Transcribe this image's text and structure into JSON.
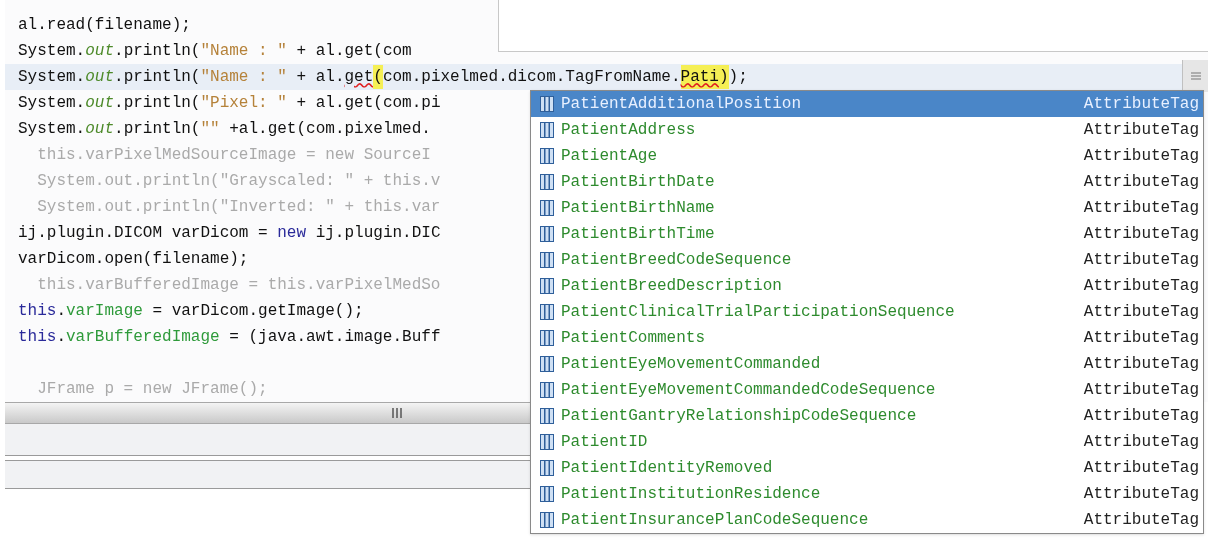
{
  "code_lines": [
    {
      "highlighted": false,
      "segments": [
        {
          "kind": "plain",
          "text": "al.read(filename);"
        }
      ]
    },
    {
      "highlighted": false,
      "segments": [
        {
          "kind": "plain",
          "text": "System."
        },
        {
          "kind": "static",
          "text": "out"
        },
        {
          "kind": "plain",
          "text": ".println("
        },
        {
          "kind": "string",
          "text": "\"Name : \""
        },
        {
          "kind": "plain",
          "text": " + al.get(com"
        }
      ]
    },
    {
      "highlighted": true,
      "segments": [
        {
          "kind": "plain",
          "text": "System."
        },
        {
          "kind": "static",
          "text": "out"
        },
        {
          "kind": "plain",
          "text": ".println("
        },
        {
          "kind": "string",
          "text": "\"Name : \""
        },
        {
          "kind": "plain",
          "text": " + al."
        },
        {
          "kind": "error",
          "text": "get"
        },
        {
          "kind": "match",
          "text": "("
        },
        {
          "kind": "plain",
          "text": "com.pixelmed.dicom.TagFromName."
        },
        {
          "kind": "error-match",
          "text": "Pati"
        },
        {
          "kind": "match",
          "text": ")"
        },
        {
          "kind": "plain",
          "text": ");"
        }
      ]
    },
    {
      "highlighted": false,
      "segments": [
        {
          "kind": "plain",
          "text": "System."
        },
        {
          "kind": "static",
          "text": "out"
        },
        {
          "kind": "plain",
          "text": ".println("
        },
        {
          "kind": "string",
          "text": "\"Pixel: \""
        },
        {
          "kind": "plain",
          "text": " + al.get(com.pi"
        }
      ]
    },
    {
      "highlighted": false,
      "segments": [
        {
          "kind": "plain",
          "text": "System."
        },
        {
          "kind": "static",
          "text": "out"
        },
        {
          "kind": "plain",
          "text": ".println("
        },
        {
          "kind": "string",
          "text": "\"\""
        },
        {
          "kind": "plain",
          "text": " +al.get(com.pixelmed."
        }
      ]
    },
    {
      "highlighted": false,
      "segments": [
        {
          "kind": "disabled",
          "text": "  this.varPixelMedSourceImage = new SourceI"
        }
      ]
    },
    {
      "highlighted": false,
      "segments": [
        {
          "kind": "disabled",
          "text": "  System.out.println(\"Grayscaled: \" + this.v"
        }
      ]
    },
    {
      "highlighted": false,
      "segments": [
        {
          "kind": "disabled",
          "text": "  System.out.println(\"Inverted: \" + this.var"
        }
      ]
    },
    {
      "highlighted": false,
      "segments": [
        {
          "kind": "plain",
          "text": "ij.plugin.DICOM varDicom = "
        },
        {
          "kind": "keyword",
          "text": "new"
        },
        {
          "kind": "plain",
          "text": " ij.plugin.DIC"
        }
      ]
    },
    {
      "highlighted": false,
      "segments": [
        {
          "kind": "plain",
          "text": "varDicom.open(filename);"
        }
      ]
    },
    {
      "highlighted": false,
      "segments": [
        {
          "kind": "disabled",
          "text": "  this.varBufferedImage = this.varPixelMedSo"
        }
      ]
    },
    {
      "highlighted": false,
      "segments": [
        {
          "kind": "keyword",
          "text": "this"
        },
        {
          "kind": "plain",
          "text": "."
        },
        {
          "kind": "member",
          "text": "varImage"
        },
        {
          "kind": "plain",
          "text": " = varDicom.getImage();"
        }
      ]
    },
    {
      "highlighted": false,
      "segments": [
        {
          "kind": "keyword",
          "text": "this"
        },
        {
          "kind": "plain",
          "text": "."
        },
        {
          "kind": "member",
          "text": "varBufferedImage"
        },
        {
          "kind": "plain",
          "text": " = (java.awt.image.Buff"
        }
      ]
    },
    {
      "highlighted": false
    },
    {
      "highlighted": false,
      "segments": [
        {
          "kind": "disabled",
          "text": "  JFrame p = new JFrame();"
        }
      ]
    }
  ],
  "completion_popup": {
    "items": [
      {
        "name": "PatientAdditionalPosition",
        "type": "AttributeTag",
        "selected": true
      },
      {
        "name": "PatientAddress",
        "type": "AttributeTag",
        "selected": false
      },
      {
        "name": "PatientAge",
        "type": "AttributeTag",
        "selected": false
      },
      {
        "name": "PatientBirthDate",
        "type": "AttributeTag",
        "selected": false
      },
      {
        "name": "PatientBirthName",
        "type": "AttributeTag",
        "selected": false
      },
      {
        "name": "PatientBirthTime",
        "type": "AttributeTag",
        "selected": false
      },
      {
        "name": "PatientBreedCodeSequence",
        "type": "AttributeTag",
        "selected": false
      },
      {
        "name": "PatientBreedDescription",
        "type": "AttributeTag",
        "selected": false
      },
      {
        "name": "PatientClinicalTrialParticipationSequence",
        "type": "AttributeTag",
        "selected": false
      },
      {
        "name": "PatientComments",
        "type": "AttributeTag",
        "selected": false
      },
      {
        "name": "PatientEyeMovementCommanded",
        "type": "AttributeTag",
        "selected": false
      },
      {
        "name": "PatientEyeMovementCommandedCodeSequence",
        "type": "AttributeTag",
        "selected": false
      },
      {
        "name": "PatientGantryRelationshipCodeSequence",
        "type": "AttributeTag",
        "selected": false
      },
      {
        "name": "PatientID",
        "type": "AttributeTag",
        "selected": false
      },
      {
        "name": "PatientIdentityRemoved",
        "type": "AttributeTag",
        "selected": false
      },
      {
        "name": "PatientInstitutionResidence",
        "type": "AttributeTag",
        "selected": false
      },
      {
        "name": "PatientInsurancePlanCodeSequence",
        "type": "AttributeTag",
        "selected": false
      }
    ]
  }
}
